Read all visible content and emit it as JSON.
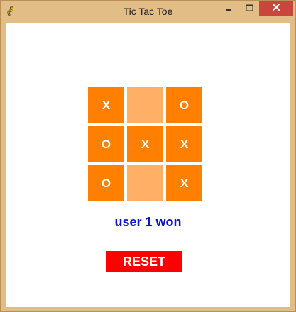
{
  "window": {
    "title": "Tic Tac Toe"
  },
  "board": {
    "cells": [
      "X",
      "",
      "O",
      "O",
      "X",
      "X",
      "O",
      "",
      "X"
    ]
  },
  "status": {
    "text": "user 1 won"
  },
  "controls": {
    "reset_label": "RESET"
  },
  "colors": {
    "cell_filled": "#ff8000",
    "cell_empty": "#ffb066",
    "status_text": "#0b16c8",
    "reset_button": "#ff0000"
  },
  "icons": {
    "app": "pygame-snake-icon",
    "minimize": "minimize-icon",
    "maximize": "maximize-icon",
    "close": "close-icon"
  }
}
